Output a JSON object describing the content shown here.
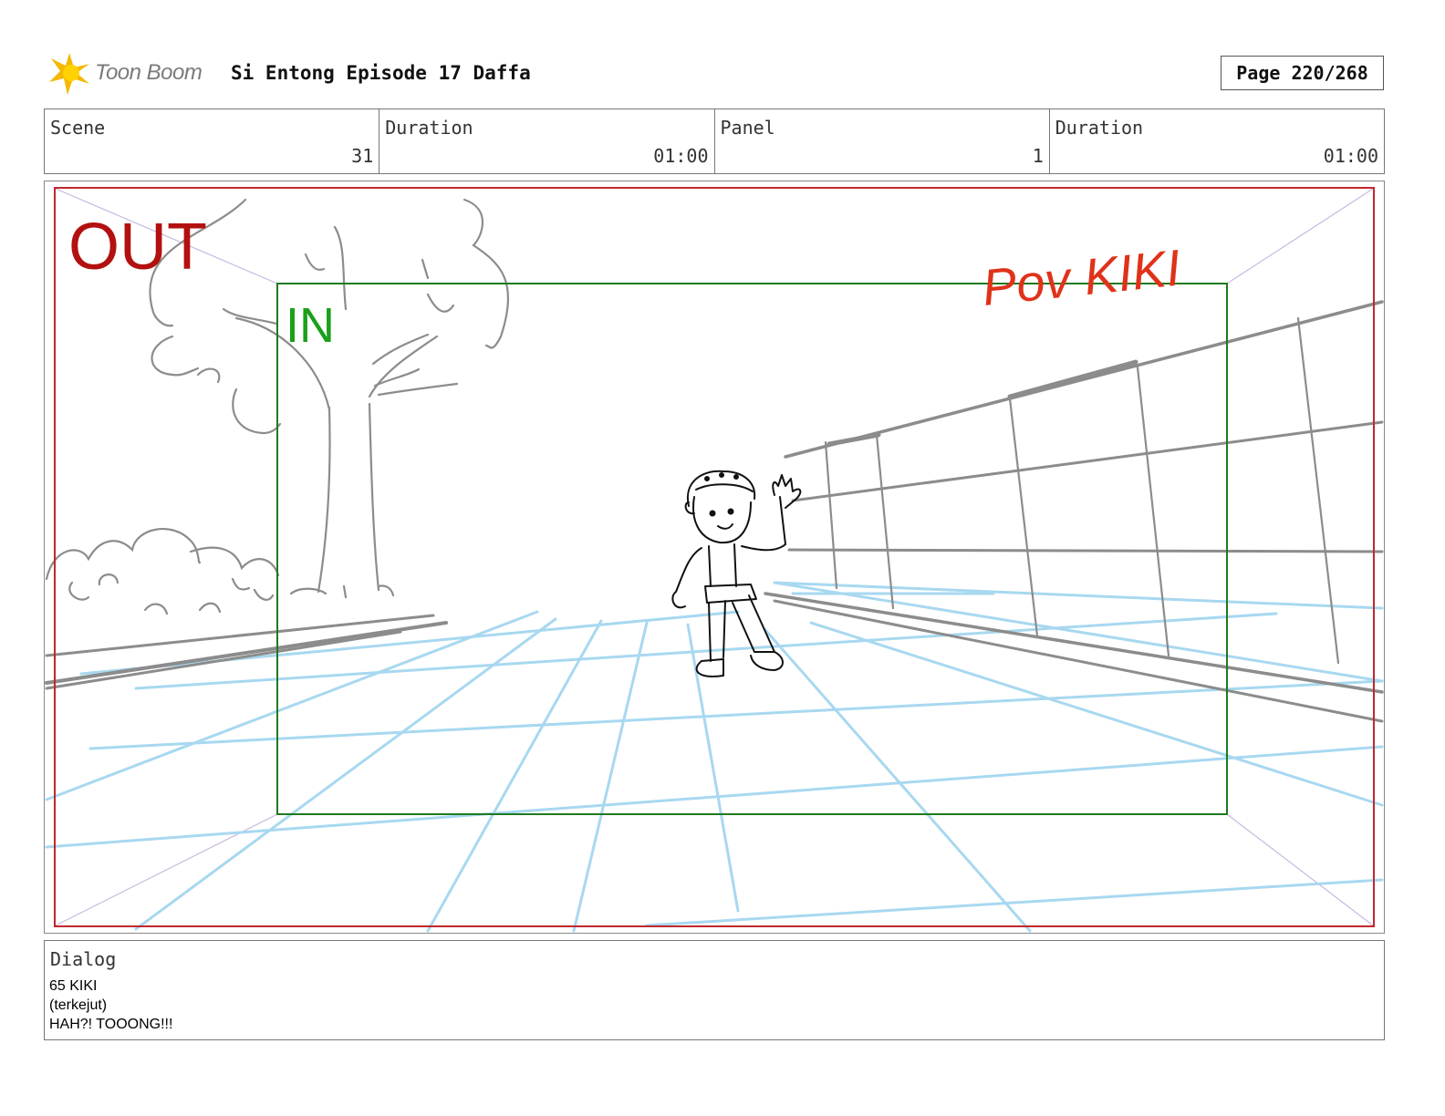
{
  "header": {
    "logo_text": "Toon Boom",
    "title": "Si Entong Episode 17 Daffa",
    "page": "Page 220/268"
  },
  "info": {
    "scene_label": "Scene",
    "scene_value": "31",
    "duration_label": "Duration",
    "duration_value": "01:00",
    "panel_label": "Panel",
    "panel_value": "1",
    "panel_duration_label": "Duration",
    "panel_duration_value": "01:00"
  },
  "panel": {
    "out_label": "OUT",
    "in_label": "IN",
    "pov_note": "Pov KIKI",
    "colors": {
      "out_frame": "#c0282d",
      "in_frame": "#1f7a1f",
      "perspective_grid": "#a8d8f0",
      "sketch": "#8c8c8c",
      "character": "#111111"
    }
  },
  "dialog": {
    "label": "Dialog",
    "lines": [
      "65 KIKI",
      "(terkejut)",
      "HAH?! TOOONG!!!"
    ]
  }
}
